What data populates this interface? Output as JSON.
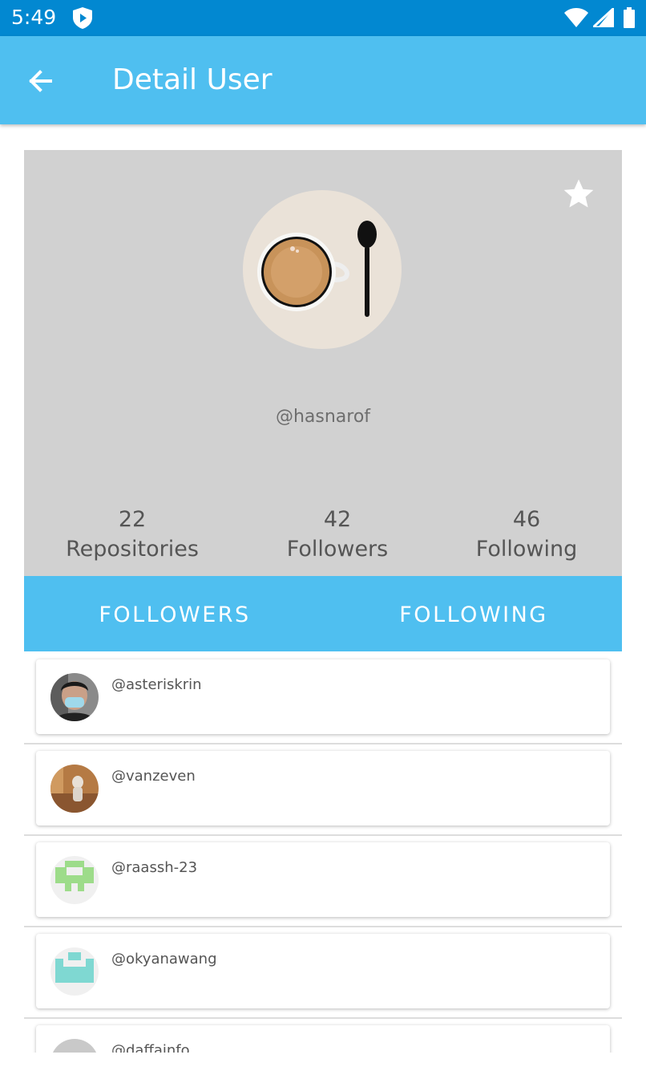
{
  "status_bar": {
    "time": "5:49",
    "icons": [
      "shield-icon",
      "wifi-icon",
      "cell-signal-icon",
      "battery-icon"
    ]
  },
  "app_bar": {
    "title": "Detail User",
    "back_icon": "arrow-back-icon"
  },
  "profile": {
    "username": "@hasnarof",
    "favorite_icon": "star-icon",
    "stats": [
      {
        "value": "22",
        "label": "Repositories"
      },
      {
        "value": "42",
        "label": "Followers"
      },
      {
        "value": "46",
        "label": "Following"
      }
    ]
  },
  "tabs": [
    {
      "label": "FOLLOWERS"
    },
    {
      "label": "FOLLOWING"
    }
  ],
  "followers": [
    {
      "username": "@asteriskrin"
    },
    {
      "username": "@vanzeven"
    },
    {
      "username": "@raassh-23"
    },
    {
      "username": "@okyanawang"
    },
    {
      "username": "@daffainfo"
    }
  ],
  "colors": {
    "status_bar": "#0288d1",
    "primary": "#4fbff0",
    "card_bg": "#d1d1d1"
  }
}
